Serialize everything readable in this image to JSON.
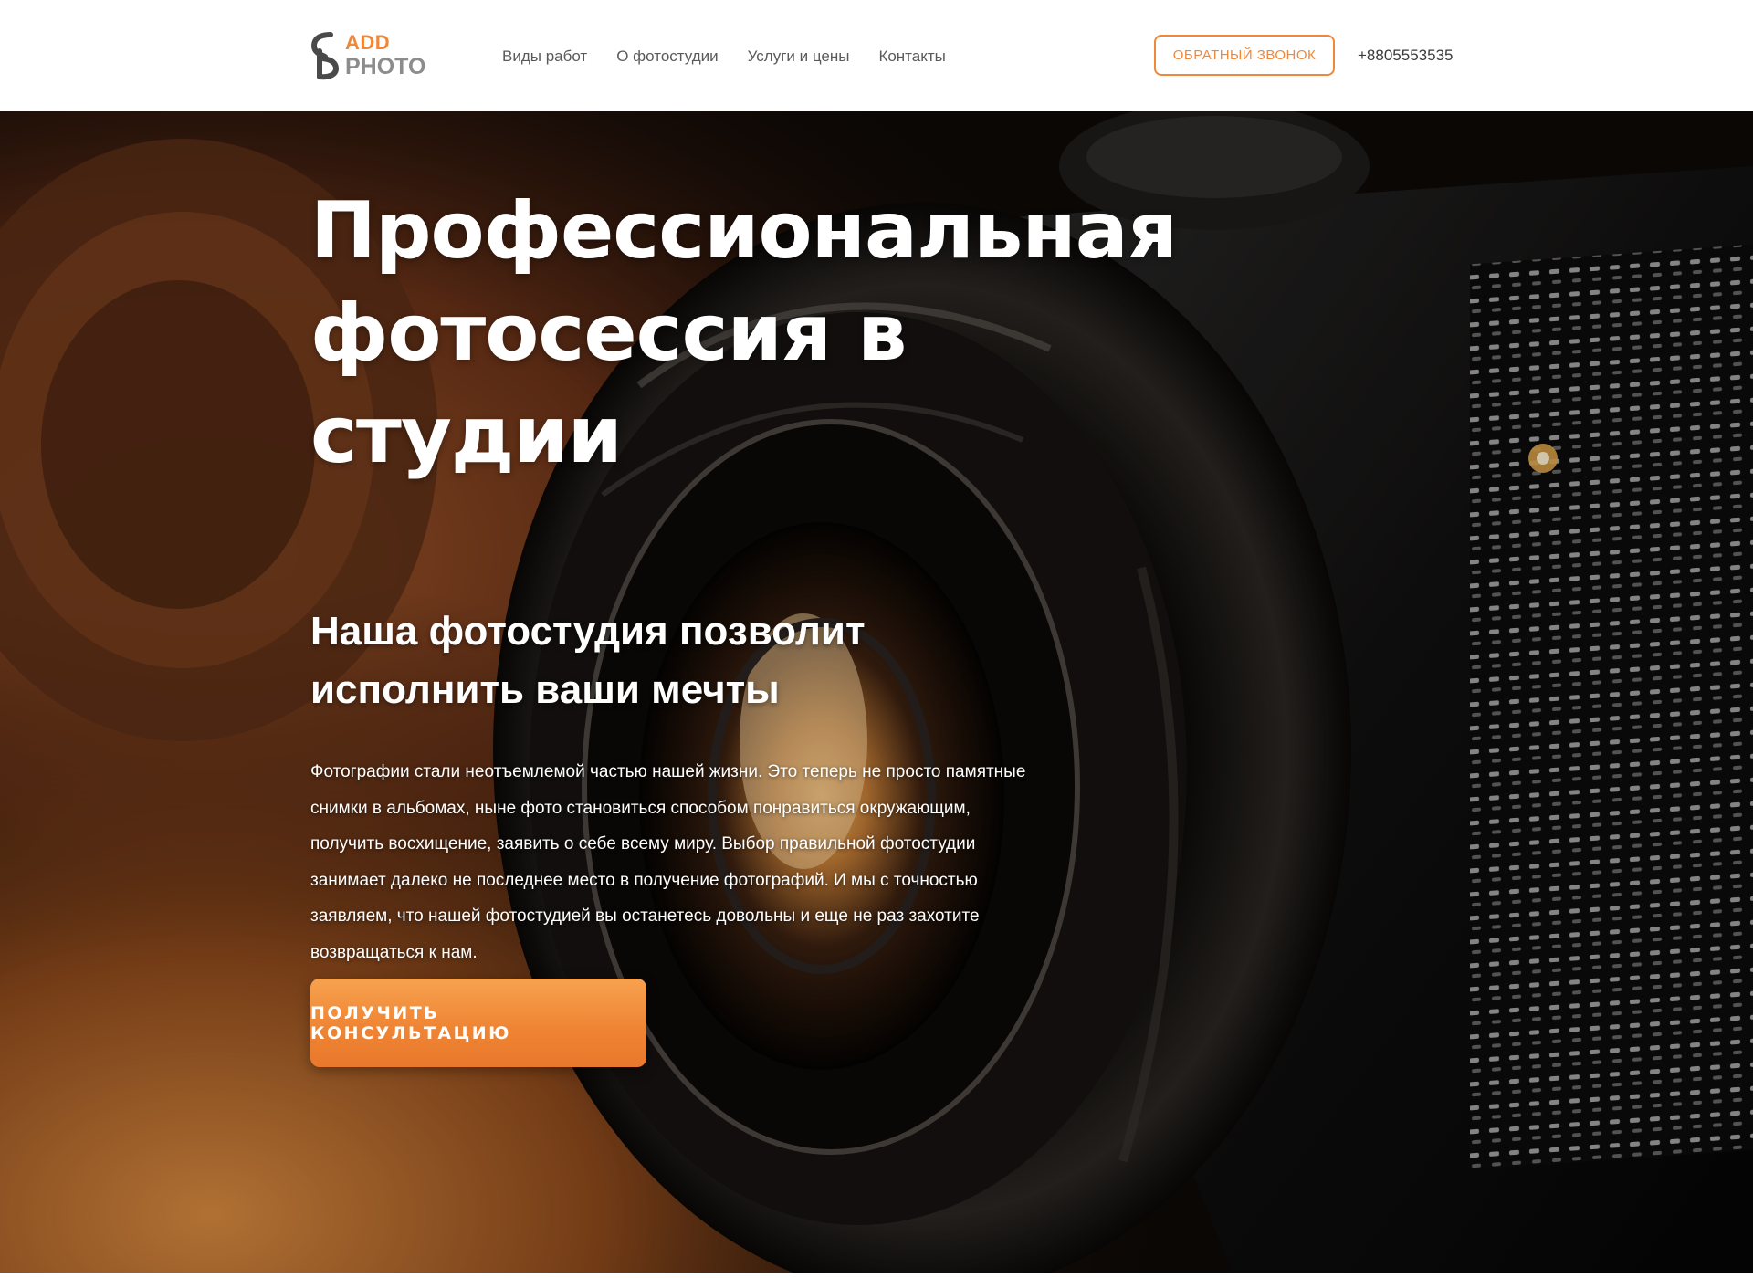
{
  "header": {
    "logo": {
      "line1": "ADD",
      "line2": "PHOTO"
    },
    "nav": [
      {
        "label": "Виды работ"
      },
      {
        "label": "О фотостудии"
      },
      {
        "label": "Услуги и цены"
      },
      {
        "label": "Контакты"
      }
    ],
    "callback_button": "ОБРАТНЫЙ ЗВОНОК",
    "phone": "+8805553535"
  },
  "hero": {
    "title": "Профессиональная фотосессия в студии",
    "subtitle": "Наша фотостудия позволит исполнить ваши мечты",
    "description": "Фотографии стали неотъемлемой частью нашей жизни. Это теперь не просто памятные снимки в альбомах, ныне фото становиться способом понравиться окружающим, получить восхищение, заявить о себе всему миру. Выбор правильной фотостудии занимает далеко не последнее место в получение фотографий. И мы с точностью заявляем, что нашей фотостудией вы останетесь довольны и еще не раз захотите возвращаться к нам.",
    "cta_button": "ПОЛУЧИТЬ КОНСУЛЬТАЦИЮ",
    "background_image": "camera-lens-photo"
  },
  "colors": {
    "accent": "#f0883b",
    "nav_text": "#5a5a5a",
    "hero_text": "#ffffff"
  }
}
